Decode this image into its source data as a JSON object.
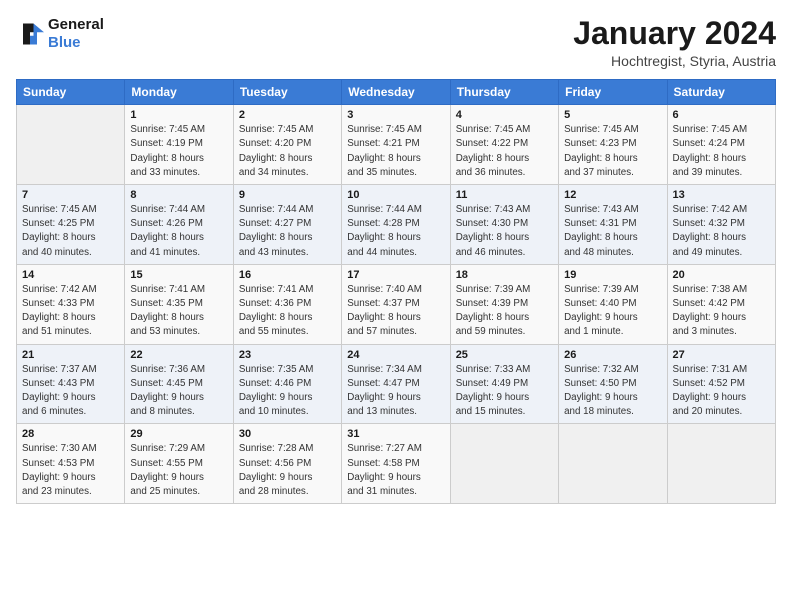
{
  "logo": {
    "line1": "General",
    "line2": "Blue"
  },
  "title": "January 2024",
  "subtitle": "Hochtregist, Styria, Austria",
  "weekdays": [
    "Sunday",
    "Monday",
    "Tuesday",
    "Wednesday",
    "Thursday",
    "Friday",
    "Saturday"
  ],
  "weeks": [
    [
      {
        "day": "",
        "info": ""
      },
      {
        "day": "1",
        "info": "Sunrise: 7:45 AM\nSunset: 4:19 PM\nDaylight: 8 hours\nand 33 minutes."
      },
      {
        "day": "2",
        "info": "Sunrise: 7:45 AM\nSunset: 4:20 PM\nDaylight: 8 hours\nand 34 minutes."
      },
      {
        "day": "3",
        "info": "Sunrise: 7:45 AM\nSunset: 4:21 PM\nDaylight: 8 hours\nand 35 minutes."
      },
      {
        "day": "4",
        "info": "Sunrise: 7:45 AM\nSunset: 4:22 PM\nDaylight: 8 hours\nand 36 minutes."
      },
      {
        "day": "5",
        "info": "Sunrise: 7:45 AM\nSunset: 4:23 PM\nDaylight: 8 hours\nand 37 minutes."
      },
      {
        "day": "6",
        "info": "Sunrise: 7:45 AM\nSunset: 4:24 PM\nDaylight: 8 hours\nand 39 minutes."
      }
    ],
    [
      {
        "day": "7",
        "info": "Sunrise: 7:45 AM\nSunset: 4:25 PM\nDaylight: 8 hours\nand 40 minutes."
      },
      {
        "day": "8",
        "info": "Sunrise: 7:44 AM\nSunset: 4:26 PM\nDaylight: 8 hours\nand 41 minutes."
      },
      {
        "day": "9",
        "info": "Sunrise: 7:44 AM\nSunset: 4:27 PM\nDaylight: 8 hours\nand 43 minutes."
      },
      {
        "day": "10",
        "info": "Sunrise: 7:44 AM\nSunset: 4:28 PM\nDaylight: 8 hours\nand 44 minutes."
      },
      {
        "day": "11",
        "info": "Sunrise: 7:43 AM\nSunset: 4:30 PM\nDaylight: 8 hours\nand 46 minutes."
      },
      {
        "day": "12",
        "info": "Sunrise: 7:43 AM\nSunset: 4:31 PM\nDaylight: 8 hours\nand 48 minutes."
      },
      {
        "day": "13",
        "info": "Sunrise: 7:42 AM\nSunset: 4:32 PM\nDaylight: 8 hours\nand 49 minutes."
      }
    ],
    [
      {
        "day": "14",
        "info": "Sunrise: 7:42 AM\nSunset: 4:33 PM\nDaylight: 8 hours\nand 51 minutes."
      },
      {
        "day": "15",
        "info": "Sunrise: 7:41 AM\nSunset: 4:35 PM\nDaylight: 8 hours\nand 53 minutes."
      },
      {
        "day": "16",
        "info": "Sunrise: 7:41 AM\nSunset: 4:36 PM\nDaylight: 8 hours\nand 55 minutes."
      },
      {
        "day": "17",
        "info": "Sunrise: 7:40 AM\nSunset: 4:37 PM\nDaylight: 8 hours\nand 57 minutes."
      },
      {
        "day": "18",
        "info": "Sunrise: 7:39 AM\nSunset: 4:39 PM\nDaylight: 8 hours\nand 59 minutes."
      },
      {
        "day": "19",
        "info": "Sunrise: 7:39 AM\nSunset: 4:40 PM\nDaylight: 9 hours\nand 1 minute."
      },
      {
        "day": "20",
        "info": "Sunrise: 7:38 AM\nSunset: 4:42 PM\nDaylight: 9 hours\nand 3 minutes."
      }
    ],
    [
      {
        "day": "21",
        "info": "Sunrise: 7:37 AM\nSunset: 4:43 PM\nDaylight: 9 hours\nand 6 minutes."
      },
      {
        "day": "22",
        "info": "Sunrise: 7:36 AM\nSunset: 4:45 PM\nDaylight: 9 hours\nand 8 minutes."
      },
      {
        "day": "23",
        "info": "Sunrise: 7:35 AM\nSunset: 4:46 PM\nDaylight: 9 hours\nand 10 minutes."
      },
      {
        "day": "24",
        "info": "Sunrise: 7:34 AM\nSunset: 4:47 PM\nDaylight: 9 hours\nand 13 minutes."
      },
      {
        "day": "25",
        "info": "Sunrise: 7:33 AM\nSunset: 4:49 PM\nDaylight: 9 hours\nand 15 minutes."
      },
      {
        "day": "26",
        "info": "Sunrise: 7:32 AM\nSunset: 4:50 PM\nDaylight: 9 hours\nand 18 minutes."
      },
      {
        "day": "27",
        "info": "Sunrise: 7:31 AM\nSunset: 4:52 PM\nDaylight: 9 hours\nand 20 minutes."
      }
    ],
    [
      {
        "day": "28",
        "info": "Sunrise: 7:30 AM\nSunset: 4:53 PM\nDaylight: 9 hours\nand 23 minutes."
      },
      {
        "day": "29",
        "info": "Sunrise: 7:29 AM\nSunset: 4:55 PM\nDaylight: 9 hours\nand 25 minutes."
      },
      {
        "day": "30",
        "info": "Sunrise: 7:28 AM\nSunset: 4:56 PM\nDaylight: 9 hours\nand 28 minutes."
      },
      {
        "day": "31",
        "info": "Sunrise: 7:27 AM\nSunset: 4:58 PM\nDaylight: 9 hours\nand 31 minutes."
      },
      {
        "day": "",
        "info": ""
      },
      {
        "day": "",
        "info": ""
      },
      {
        "day": "",
        "info": ""
      }
    ]
  ]
}
